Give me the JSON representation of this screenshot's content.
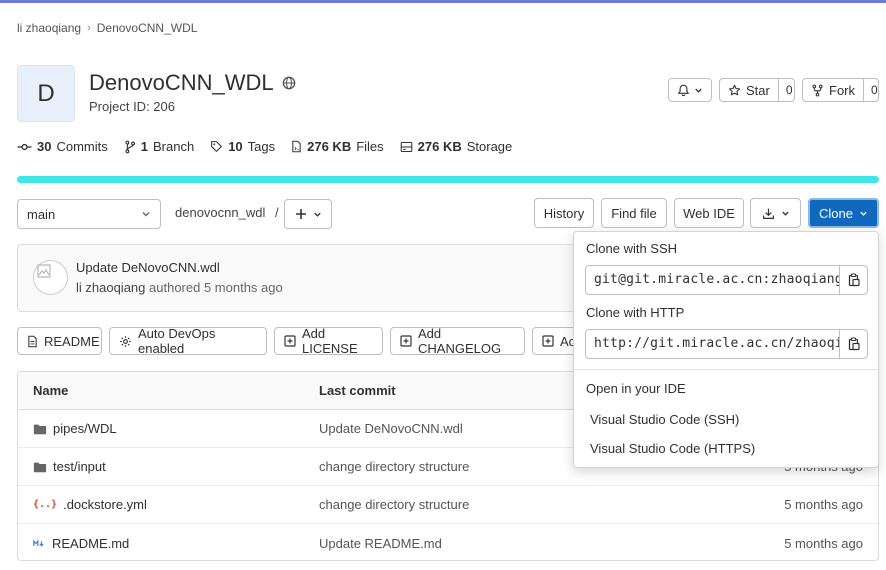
{
  "breadcrumb": {
    "owner": "li zhaoqiang",
    "project": "DenovoCNN_WDL"
  },
  "project": {
    "avatar_letter": "D",
    "name": "DenovoCNN_WDL",
    "id_text": "Project ID: 206"
  },
  "actions": {
    "star_label": "Star",
    "star_count": "0",
    "fork_label": "Fork",
    "fork_count": "0"
  },
  "stats": {
    "commits_count": "30",
    "commits_label": "Commits",
    "branch_count": "1",
    "branch_label": "Branch",
    "tags_count": "10",
    "tags_label": "Tags",
    "files_size": "276 KB",
    "files_label": "Files",
    "storage_size": "276 KB",
    "storage_label": "Storage"
  },
  "toolbar": {
    "branch": "main",
    "path": "denovocnn_wdl",
    "path_sep": "/",
    "history": "History",
    "find_file": "Find file",
    "web_ide": "Web IDE",
    "clone": "Clone"
  },
  "last_commit": {
    "message": "Update DeNovoCNN.wdl",
    "author": "li zhaoqiang",
    "meta": "authored 5 months ago"
  },
  "chips": {
    "readme": "README",
    "devops": "Auto DevOps enabled",
    "license": "Add LICENSE",
    "changelog": "Add CHANGELOG",
    "extra": "Ac"
  },
  "table": {
    "headers": {
      "name": "Name",
      "last_commit": "Last commit"
    },
    "rows": [
      {
        "name": "pipes/WDL",
        "icon": "folder-icon",
        "commit": "Update DeNovoCNN.wdl",
        "date": ""
      },
      {
        "name": "test/input",
        "icon": "folder-icon",
        "commit": "change directory structure",
        "date": "5 months ago"
      },
      {
        "name": ".dockstore.yml",
        "icon": "yaml-file-icon",
        "commit": "change directory structure",
        "date": "5 months ago"
      },
      {
        "name": "README.md",
        "icon": "markdown-file-icon",
        "commit": "Update README.md",
        "date": "5 months ago"
      }
    ]
  },
  "clone_dropdown": {
    "ssh_label": "Clone with SSH",
    "ssh_url": "git@git.miracle.ac.cn:zhaoqiang/denovocnn_wdl.git",
    "http_label": "Clone with HTTP",
    "http_url": "http://git.miracle.ac.cn/zhaoqiang/denovocnn_wdl.git",
    "ide_label": "Open in your IDE",
    "ide_ssh": "Visual Studio Code (SSH)",
    "ide_https": "Visual Studio Code (HTTPS)"
  },
  "colors": {
    "progress": "#3ee6e6",
    "clone_button": "#1068bf",
    "yaml_icon": "#e24329",
    "markdown_icon": "#4a86c8"
  }
}
